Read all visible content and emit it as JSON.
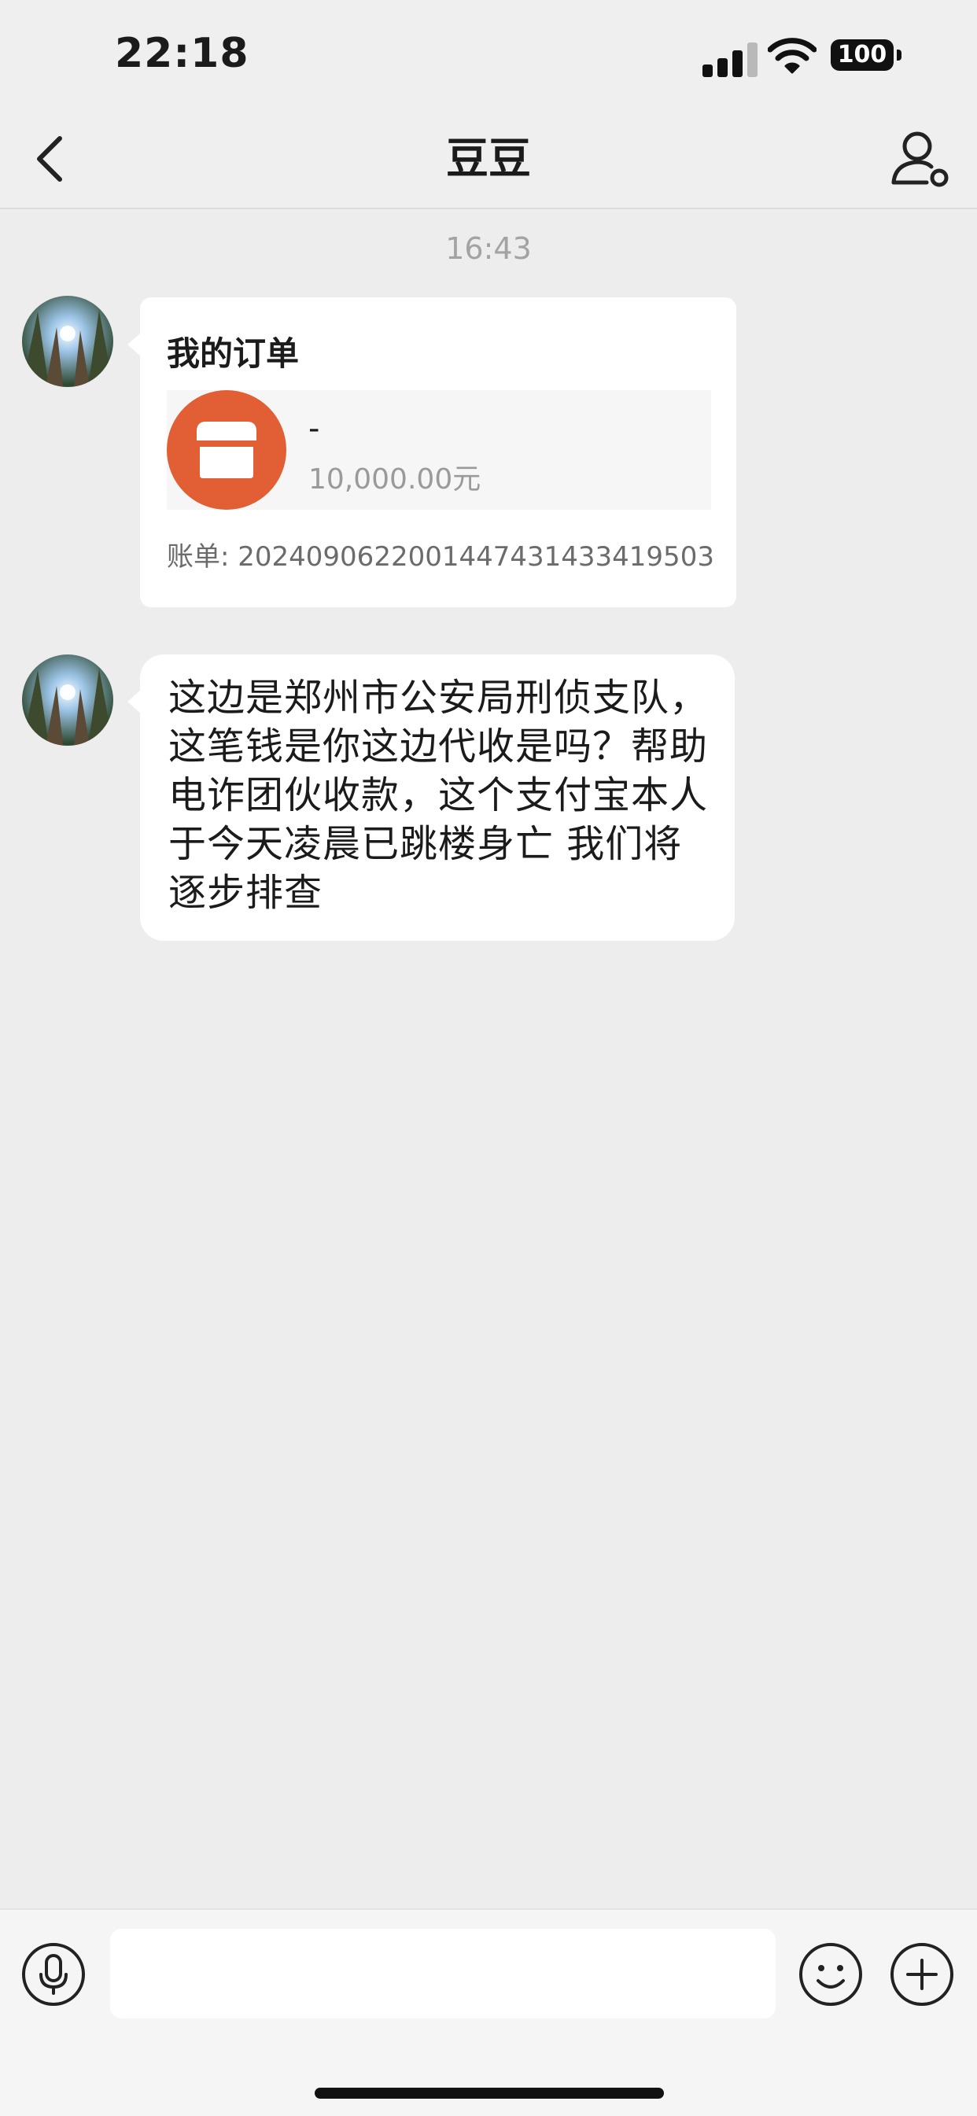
{
  "status_bar": {
    "time": "22:18",
    "battery": "100"
  },
  "nav": {
    "title": "豆豆",
    "back_icon": "chevron-left-icon",
    "contact_icon": "person-settings-icon"
  },
  "chat": {
    "timestamp": "16:43",
    "order_card": {
      "title": "我的订单",
      "item_name": "-",
      "item_price": "10,000.00元",
      "bill": "账单: 20240906220014474314334195​03",
      "shop_icon": "shop-icon"
    },
    "text_message": "这边是郑州市公安局刑侦支队，这笔钱是你这边代收是吗？帮助电诈团伙收款，这个支付宝本人于今天凌晨已跳楼身亡 我们将逐步排查"
  },
  "input_bar": {
    "placeholder": "",
    "voice_icon": "microphone-icon",
    "emoji_icon": "emoji-icon",
    "plus_icon": "plus-icon"
  },
  "colors": {
    "background": "#ededed",
    "accent_orange": "#e25e34",
    "bubble": "#ffffff"
  }
}
